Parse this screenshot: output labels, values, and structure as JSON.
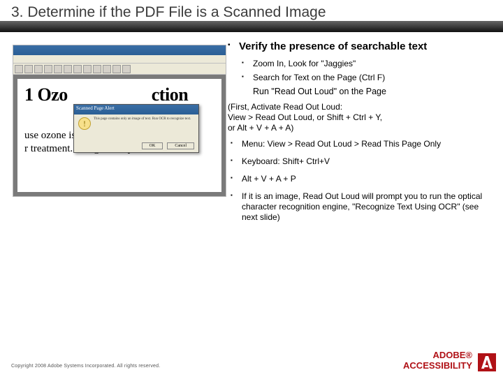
{
  "title": "3. Determine if the PDF File is a Scanned Image",
  "screenshot": {
    "heading": "1  Ozo",
    "heading_suffix": "ction",
    "body_line1": "use ozone is an unstable molecul",
    "body_line2": "r treatment.  It is generally forme",
    "dialog_title": "Scanned Page Alert",
    "dialog_ok": "OK",
    "dialog_cancel": "Cancel"
  },
  "bullets": {
    "lead": "Verify the presence of searchable text",
    "sub": [
      "Zoom In, Look for \"Jaggies\"",
      "Search for Text on the Page (Ctrl F)"
    ],
    "orphan": "Run \"Read Out Loud\" on the Page",
    "paren": "(First, Activate Read Out Loud:\nView > Read Out Loud, or Shift + Ctrl + Y,\nor Alt + V + A + A)",
    "sub2": [
      "Menu: View > Read Out Loud > Read This Page Only",
      "Keyboard: Shift+ Ctrl+V",
      "Alt + V + A + P",
      "If it is an image, Read Out Loud will prompt you to run the optical character recognition engine, \"Recognize Text Using OCR\" (see next slide)"
    ]
  },
  "footer": {
    "copyright": "Copyright 2008 Adobe Systems Incorporated.  All rights reserved.",
    "brand_line1": "ADOBE®",
    "brand_line2": "ACCESSIBILITY"
  }
}
